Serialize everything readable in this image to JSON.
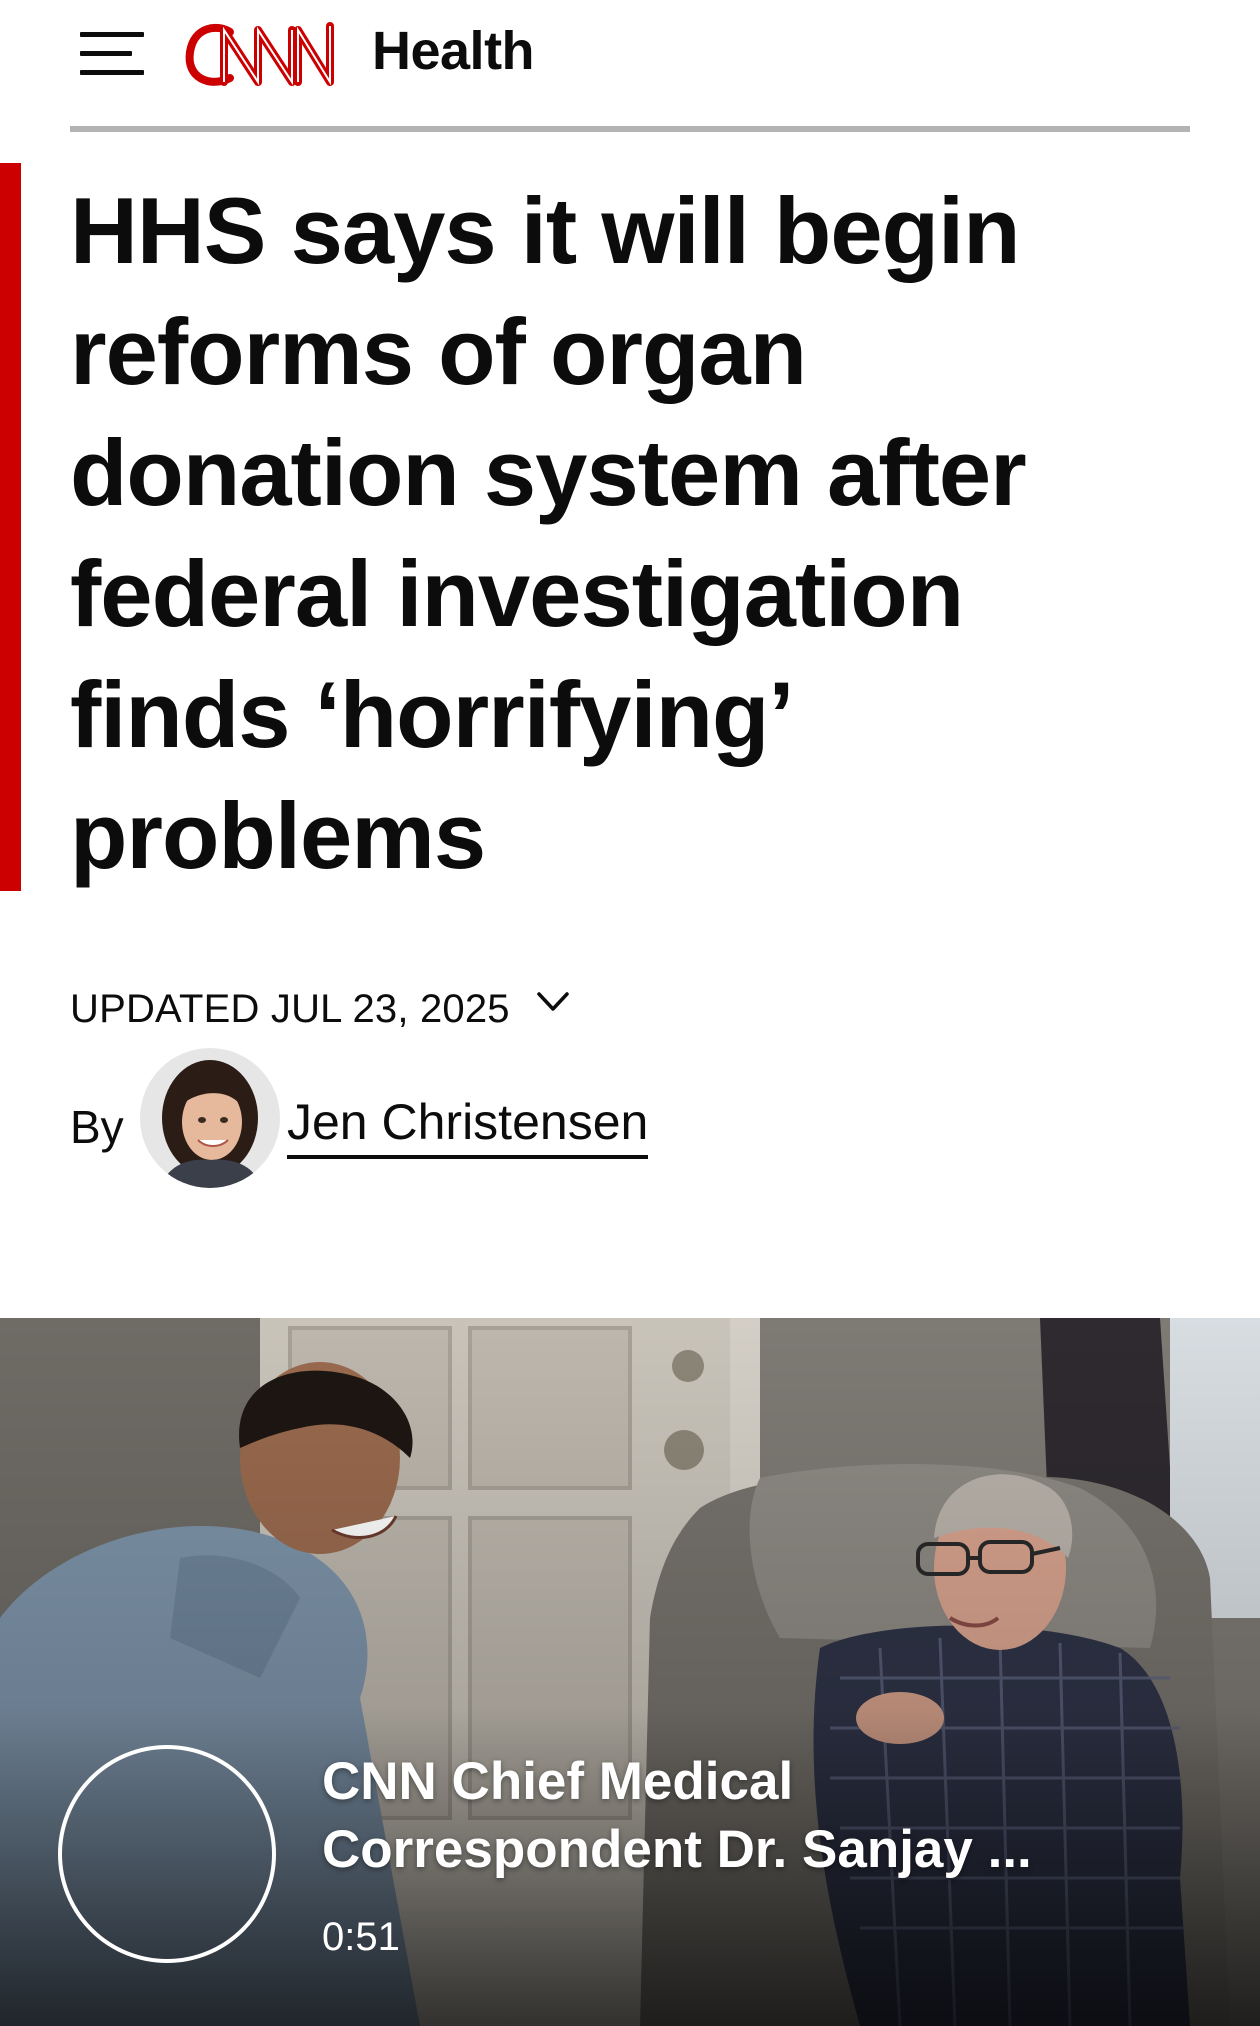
{
  "header": {
    "menu_icon": "hamburger-menu-icon",
    "logo_text": "CNN",
    "section": "Health",
    "brand_color": "#cc0000"
  },
  "article": {
    "headline": "HHS says it will begin reforms of organ donation system after federal investigation finds ‘horrifying’ problems",
    "timestamp": "UPDATED JUL 23, 2025",
    "timestamp_icon": "chevron-down-icon",
    "byline_prefix": "By",
    "author": "Jen Christensen"
  },
  "video": {
    "title": "CNN Chief Medical Correspondent Dr. Sanjay ...",
    "duration": "0:51",
    "play_icon": "play-ring-icon"
  }
}
